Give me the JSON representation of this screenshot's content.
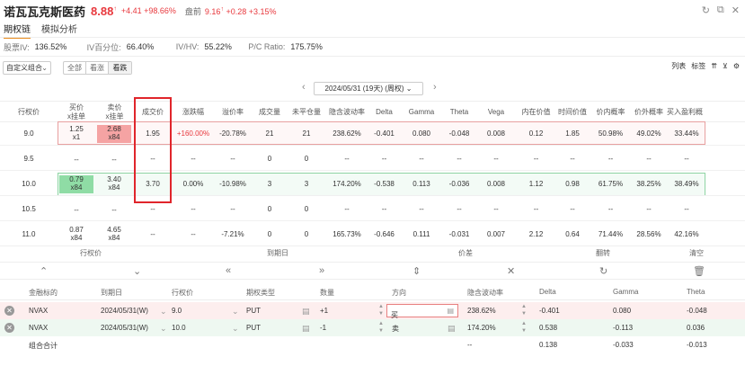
{
  "header": {
    "name": "诺瓦瓦克斯医药",
    "price": "8.88",
    "change": "+4.41",
    "change_pct": "+98.66%",
    "premarket_label": "盘前",
    "premarket_price": "9.16",
    "premarket_change": "+0.28",
    "premarket_change_pct": "+3.15%",
    "colors": {
      "up": "#e8383d",
      "accent": "#e88a1a"
    }
  },
  "tabs": [
    "期权链",
    "模拟分析"
  ],
  "stats": [
    {
      "label": "股票IV:",
      "value": "136.52%"
    },
    {
      "label": "IV百分位:",
      "value": "66.40%"
    },
    {
      "label": "IV/HV:",
      "value": "55.22%"
    },
    {
      "label": "P/C Ratio:",
      "value": "175.75%"
    }
  ],
  "toolbar": {
    "combo_select": "自定义组合",
    "segments": [
      "全部",
      "看涨",
      "看跌"
    ],
    "right": [
      "列表",
      "标签"
    ]
  },
  "expiry": {
    "label": "2024/05/31 (19天) (周权)"
  },
  "chain_columns": [
    "行权价",
    "买价\nx挂单",
    "卖价\nx挂单",
    "成交价",
    "涨跌幅",
    "溢价率",
    "成交量",
    "未平仓量",
    "隐含波动率",
    "Delta",
    "Gamma",
    "Theta",
    "Vega",
    "内在价值",
    "时间价值",
    "价内概率",
    "价外概率",
    "买入盈利概"
  ],
  "chain_rows": [
    {
      "strike": "9.0",
      "bid": "1.25",
      "bid_size": "x1",
      "ask": "2.68",
      "ask_size": "x84",
      "last": "1.95",
      "chg": "+160.00%",
      "premium": "-20.78%",
      "volume": "21",
      "oi": "21",
      "iv": "238.62%",
      "delta": "-0.401",
      "gamma": "0.080",
      "theta": "-0.048",
      "vega": "0.008",
      "intrinsic": "0.12",
      "time_value": "1.85",
      "itm_prob": "50.98%",
      "otm_prob": "49.02%",
      "profit_prob": "33.44%"
    },
    {
      "strike": "9.5",
      "bid": "--",
      "bid_size": "",
      "ask": "--",
      "ask_size": "",
      "last": "--",
      "chg": "--",
      "premium": "--",
      "volume": "0",
      "oi": "0",
      "iv": "--",
      "delta": "--",
      "gamma": "--",
      "theta": "--",
      "vega": "--",
      "intrinsic": "--",
      "time_value": "--",
      "itm_prob": "--",
      "otm_prob": "--",
      "profit_prob": "--"
    },
    {
      "strike": "10.0",
      "bid": "0.79",
      "bid_size": "x84",
      "ask": "3.40",
      "ask_size": "x84",
      "last": "3.70",
      "chg": "0.00%",
      "premium": "-10.98%",
      "volume": "3",
      "oi": "3",
      "iv": "174.20%",
      "delta": "-0.538",
      "gamma": "0.113",
      "theta": "-0.036",
      "vega": "0.008",
      "intrinsic": "1.12",
      "time_value": "0.98",
      "itm_prob": "61.75%",
      "otm_prob": "38.25%",
      "profit_prob": "38.49%"
    },
    {
      "strike": "10.5",
      "bid": "--",
      "bid_size": "",
      "ask": "--",
      "ask_size": "",
      "last": "--",
      "chg": "--",
      "premium": "--",
      "volume": "0",
      "oi": "0",
      "iv": "--",
      "delta": "--",
      "gamma": "--",
      "theta": "--",
      "vega": "--",
      "intrinsic": "--",
      "time_value": "--",
      "itm_prob": "--",
      "otm_prob": "--",
      "profit_prob": "--"
    },
    {
      "strike": "11.0",
      "bid": "0.87",
      "bid_size": "x84",
      "ask": "4.65",
      "ask_size": "x84",
      "last": "--",
      "chg": "--",
      "premium": "-7.21%",
      "volume": "0",
      "oi": "0",
      "iv": "165.73%",
      "delta": "-0.646",
      "gamma": "0.111",
      "theta": "-0.031",
      "vega": "0.007",
      "intrinsic": "2.12",
      "time_value": "0.64",
      "itm_prob": "71.44%",
      "otm_prob": "28.56%",
      "profit_prob": "42.16%"
    }
  ],
  "ops": {
    "labels": [
      "行权价",
      "到期日",
      "价差",
      "翻转",
      "清空"
    ]
  },
  "positions": {
    "columns": [
      "金融标的",
      "到期日",
      "行权价",
      "期权类型",
      "数量",
      "方向",
      "隐含波动率",
      "Delta",
      "Gamma",
      "Theta"
    ],
    "rows": [
      {
        "symbol": "NVAX",
        "expiry": "2024/05/31(W)",
        "strike": "9.0",
        "type": "PUT",
        "qty": "+1",
        "direction": "买",
        "iv": "238.62%",
        "delta": "-0.401",
        "gamma": "0.080",
        "theta": "-0.048"
      },
      {
        "symbol": "NVAX",
        "expiry": "2024/05/31(W)",
        "strike": "10.0",
        "type": "PUT",
        "qty": "-1",
        "direction": "卖",
        "iv": "174.20%",
        "delta": "0.538",
        "gamma": "-0.113",
        "theta": "0.036"
      }
    ],
    "total": {
      "label": "组合合计",
      "iv": "--",
      "delta": "0.138",
      "gamma": "-0.033",
      "theta": "-0.013"
    }
  }
}
